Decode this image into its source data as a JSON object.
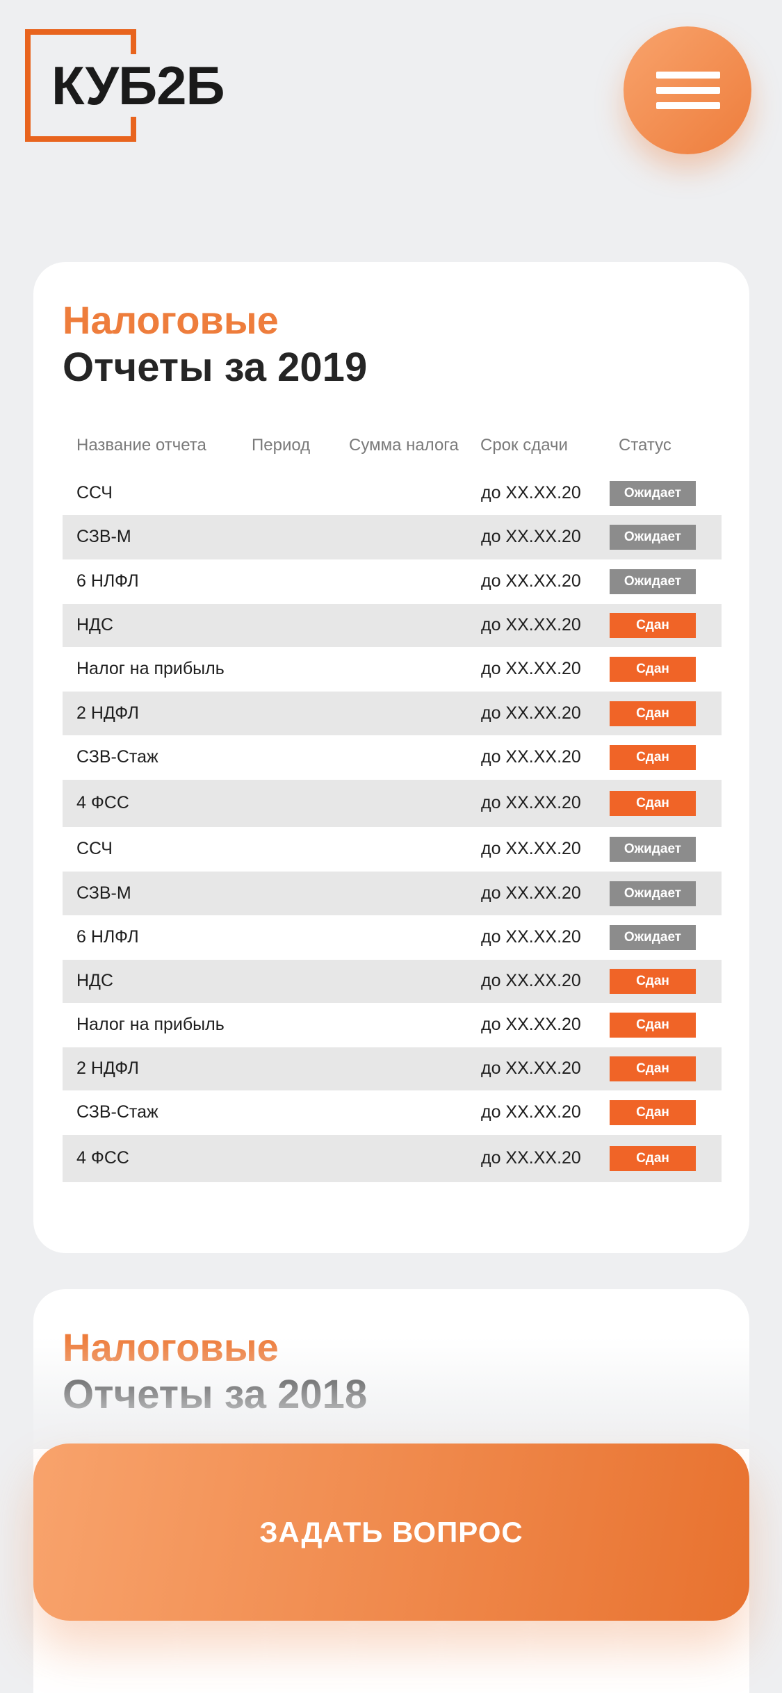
{
  "header": {
    "logo_text": "КУБ2Б",
    "menu_icon": "hamburger-menu-icon",
    "accent_color": "#ee7d3c"
  },
  "card_2019": {
    "title_orange": "Налоговые",
    "title_dark": "Отчеты за 2019",
    "columns": [
      "Название отчета",
      "Период",
      "Сумма налога",
      "Срок сдачи",
      "Статус"
    ],
    "rows": [
      {
        "name": "ССЧ",
        "period": "",
        "sum": "",
        "due": "до XX.XX.20",
        "status": "Ожидает",
        "status_type": "wait"
      },
      {
        "name": "СЗВ-М",
        "period": "",
        "sum": "",
        "due": "до XX.XX.20",
        "status": "Ожидает",
        "status_type": "wait"
      },
      {
        "name": "6 НЛФЛ",
        "period": "",
        "sum": "",
        "due": "до XX.XX.20",
        "status": "Ожидает",
        "status_type": "wait"
      },
      {
        "name": "НДС",
        "period": "",
        "sum": "",
        "due": "до XX.XX.20",
        "status": "Сдан",
        "status_type": "done"
      },
      {
        "name": "Налог на прибыль",
        "period": "",
        "sum": "",
        "due": "до XX.XX.20",
        "status": "Сдан",
        "status_type": "done"
      },
      {
        "name": "2 НДФЛ",
        "period": "",
        "sum": "",
        "due": "до XX.XX.20",
        "status": "Сдан",
        "status_type": "done"
      },
      {
        "name": "СЗВ-Стаж",
        "period": "",
        "sum": "",
        "due": "до XX.XX.20",
        "status": "Сдан",
        "status_type": "done"
      },
      {
        "name": "4 ФСС",
        "period": "",
        "sum": "",
        "due": "до XX.XX.20",
        "status": "Сдан",
        "status_type": "done"
      },
      {
        "name": "ССЧ",
        "period": "",
        "sum": "",
        "due": "до XX.XX.20",
        "status": "Ожидает",
        "status_type": "wait"
      },
      {
        "name": "СЗВ-М",
        "period": "",
        "sum": "",
        "due": "до XX.XX.20",
        "status": "Ожидает",
        "status_type": "wait"
      },
      {
        "name": "6 НЛФЛ",
        "period": "",
        "sum": "",
        "due": "до XX.XX.20",
        "status": "Ожидает",
        "status_type": "wait"
      },
      {
        "name": "НДС",
        "period": "",
        "sum": "",
        "due": "до XX.XX.20",
        "status": "Сдан",
        "status_type": "done"
      },
      {
        "name": "Налог на прибыль",
        "period": "",
        "sum": "",
        "due": "до XX.XX.20",
        "status": "Сдан",
        "status_type": "done"
      },
      {
        "name": "2 НДФЛ",
        "period": "",
        "sum": "",
        "due": "до XX.XX.20",
        "status": "Сдан",
        "status_type": "done"
      },
      {
        "name": "СЗВ-Стаж",
        "period": "",
        "sum": "",
        "due": "до XX.XX.20",
        "status": "Сдан",
        "status_type": "done"
      },
      {
        "name": "4 ФСС",
        "period": "",
        "sum": "",
        "due": "до XX.XX.20",
        "status": "Сдан",
        "status_type": "done"
      }
    ]
  },
  "card_2018": {
    "title_orange": "Налоговые",
    "title_dark": "Отчеты за 2018"
  },
  "cta": {
    "label": "ЗАДАТЬ ВОПРОС"
  },
  "colors": {
    "status_wait": "#8c8c8c",
    "status_done": "#f06427",
    "row_shade": "#e7e7e7"
  }
}
